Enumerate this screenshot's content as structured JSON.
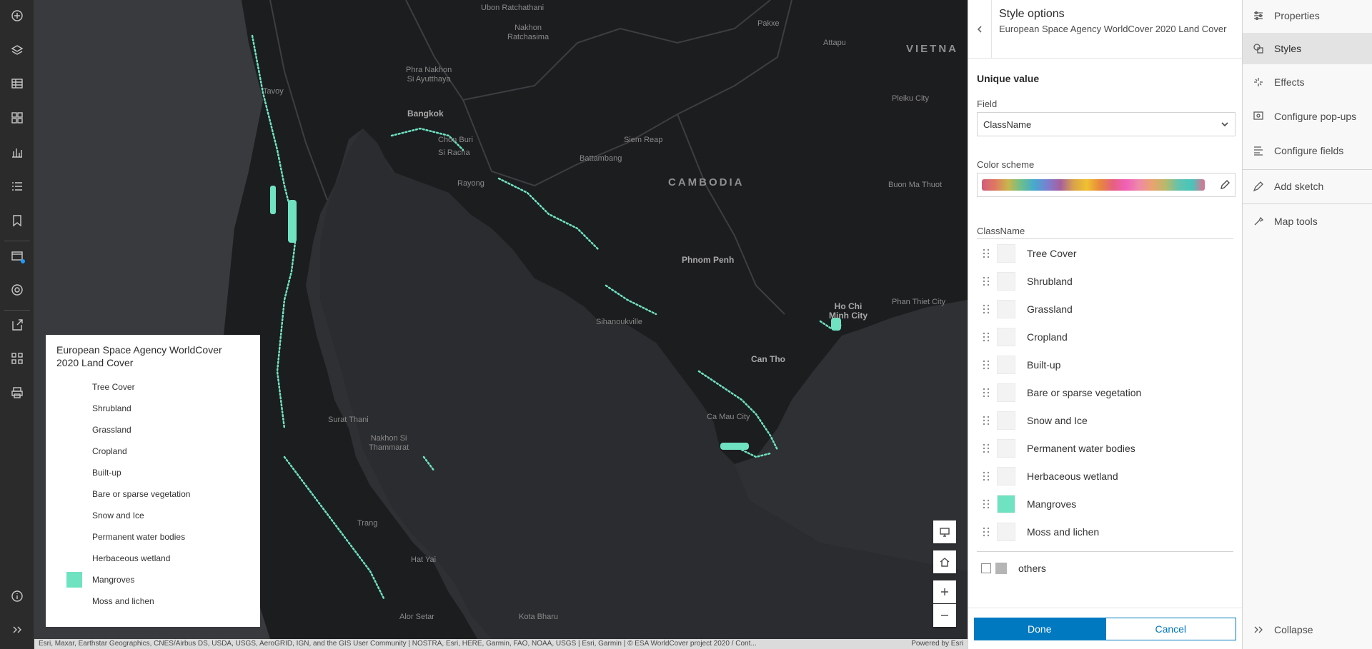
{
  "left_toolbar": {
    "icons": [
      "add-icon",
      "layers-icon",
      "table-icon",
      "basemap-icon",
      "charts-icon",
      "legend-icon",
      "bookmarks-icon",
      "map-properties-icon",
      "settings-icon",
      "share-icon",
      "create-app-icon",
      "print-icon",
      "info-icon",
      "expand-icon"
    ]
  },
  "map": {
    "labels": {
      "ubon": "Ubon\nRatchathani",
      "pakxe": "Pakxe",
      "attapu": "Attapu",
      "nakhon": "Nakhon\nRatchasima",
      "vietnam": "VIETNA",
      "phra": "Phra Nakhon\nSi Ayutthaya",
      "pleiku": "Pleiku City",
      "bangkok": "Bangkok",
      "chonburi": "Chon Buri",
      "sriracha": "Si Racha",
      "siemreap": "Siem Reap",
      "battambang": "Battambang",
      "cambodia": "CAMBODIA",
      "rayong": "Rayong",
      "buonma": "Buon Ma Thuot",
      "phnompenh": "Phnom Penh",
      "hochiminh": "Ho Chi\nMinh City",
      "phanthiet": "Phan Thiet City",
      "sihanouk": "Sihanoukville",
      "cantho": "Can Tho",
      "camau": "Ca Mau City",
      "surat": "Surat Thani",
      "nakhonsi": "Nakhon Si\nThammarat",
      "trang": "Trang",
      "hatyai": "Hat Yai",
      "alorsetar": "Alor Setar",
      "kotabharu": "Kota Bharu",
      "tavoy": "Tavoy"
    },
    "controls": [
      "default-extent-icon",
      "home-icon",
      "zoom-in-icon",
      "zoom-out-icon"
    ]
  },
  "legend": {
    "title": "European Space Agency WorldCover 2020 Land Cover",
    "items": [
      {
        "label": "Tree Cover",
        "color": "#ffffff"
      },
      {
        "label": "Shrubland",
        "color": "#ffffff"
      },
      {
        "label": "Grassland",
        "color": "#ffffff"
      },
      {
        "label": "Cropland",
        "color": "#ffffff"
      },
      {
        "label": "Built-up",
        "color": "#ffffff"
      },
      {
        "label": "Bare or sparse vegetation",
        "color": "#ffffff"
      },
      {
        "label": "Snow and Ice",
        "color": "#ffffff"
      },
      {
        "label": "Permanent water bodies",
        "color": "#ffffff"
      },
      {
        "label": "Herbaceous wetland",
        "color": "#ffffff"
      },
      {
        "label": "Mangroves",
        "color": "#6fe3c1"
      },
      {
        "label": "Moss and lichen",
        "color": "#ffffff"
      }
    ]
  },
  "attribution": {
    "text": "Esri, Maxar, Earthstar Geographics, CNES/Airbus DS, USDA, USGS, AeroGRID, IGN, and the GIS User Community | NOSTRA, Esri, HERE, Garmin, FAO, NOAA, USGS | Esri, Garmin | © ESA WorldCover project 2020 / Cont...",
    "powered": "Powered by Esri"
  },
  "style_panel": {
    "title": "Style options",
    "subtitle": "European Space Agency WorldCover 2020 Land Cover",
    "section": "Unique value",
    "field_label": "Field",
    "field_value": "ClassName",
    "color_scheme_label": "Color scheme",
    "classname_header": "ClassName",
    "classes": [
      {
        "label": "Tree Cover",
        "color": "#f3f3f3"
      },
      {
        "label": "Shrubland",
        "color": "#f3f3f3"
      },
      {
        "label": "Grassland",
        "color": "#f3f3f3"
      },
      {
        "label": "Cropland",
        "color": "#f3f3f3"
      },
      {
        "label": "Built-up",
        "color": "#f3f3f3"
      },
      {
        "label": "Bare or sparse vegetation",
        "color": "#f3f3f3"
      },
      {
        "label": "Snow and Ice",
        "color": "#f3f3f3"
      },
      {
        "label": "Permanent water bodies",
        "color": "#f3f3f3"
      },
      {
        "label": "Herbaceous wetland",
        "color": "#f3f3f3"
      },
      {
        "label": "Mangroves",
        "color": "#6fe3c1"
      },
      {
        "label": "Moss and lichen",
        "color": "#f3f3f3"
      }
    ],
    "others_label": "others",
    "done_label": "Done",
    "cancel_label": "Cancel"
  },
  "right_panel": {
    "items": [
      {
        "label": "Properties",
        "icon": "properties-icon"
      },
      {
        "label": "Styles",
        "icon": "styles-icon",
        "active": true
      },
      {
        "label": "Effects",
        "icon": "effects-icon"
      },
      {
        "label": "Configure pop-ups",
        "icon": "popup-icon"
      },
      {
        "label": "Configure fields",
        "icon": "fields-icon"
      },
      {
        "label": "Add sketch",
        "icon": "sketch-icon"
      },
      {
        "label": "Map tools",
        "icon": "map-tools-icon"
      }
    ],
    "collapse_label": "Collapse"
  },
  "colors": {
    "accent": "#0079c1",
    "mangroves": "#6fe3c1"
  }
}
